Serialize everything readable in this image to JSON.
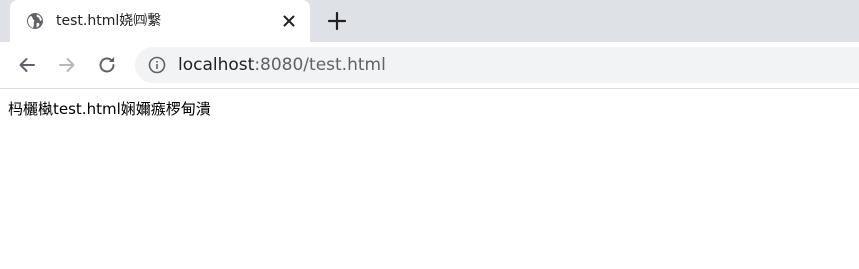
{
  "tab": {
    "title": "test.html娆㈣繋",
    "favicon": "globe-icon",
    "close": "close-icon"
  },
  "new_tab": "plus-icon",
  "toolbar": {
    "back": "arrow-left-icon",
    "forward": "arrow-right-icon",
    "reload": "reload-icon"
  },
  "omnibox": {
    "info_icon": "info-icon",
    "url_host": "localhost",
    "url_rest": ":8080/test.html"
  },
  "page": {
    "body_text": "杩欐槸test.html娴嬭瘯椤甸潰"
  },
  "colors": {
    "tabstrip_bg": "#dee1e6",
    "omnibox_bg": "#f1f3f4",
    "icon": "#5f6368",
    "icon_disabled": "#b5b8bc"
  }
}
